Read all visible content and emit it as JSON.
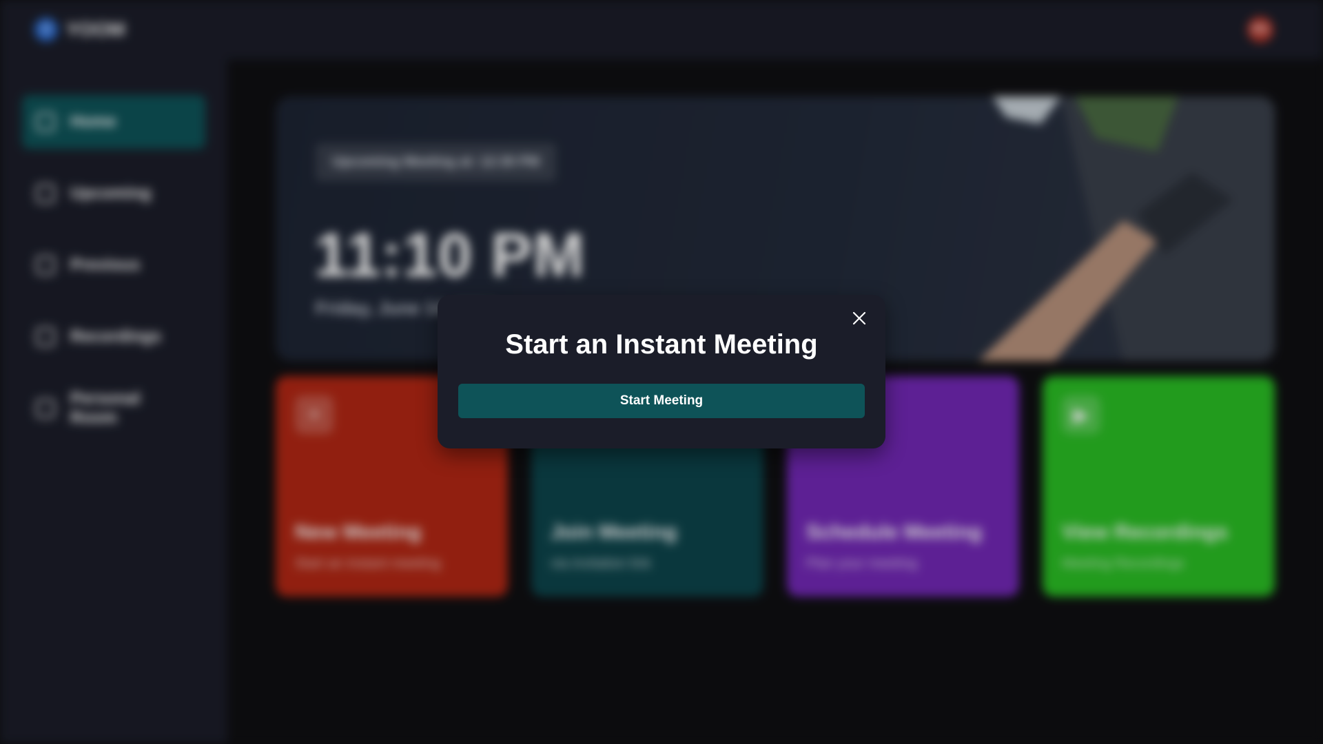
{
  "app": {
    "logo_text": "YOOM",
    "logo_letter": "Y",
    "avatar_initials": "RS"
  },
  "sidebar": {
    "items": [
      {
        "label": "Home",
        "icon": "home-icon"
      },
      {
        "label": "Upcoming",
        "icon": "calendar-icon"
      },
      {
        "label": "Previous",
        "icon": "history-icon"
      },
      {
        "label": "Recordings",
        "icon": "video-icon"
      },
      {
        "label": "Personal Room",
        "icon": "user-plus-icon"
      }
    ],
    "active_index": 0
  },
  "hero": {
    "badge": "Upcoming Meeting at: 12:30 PM",
    "time": "11:10 PM",
    "date": "Friday, June 14, 2024"
  },
  "cards": [
    {
      "title": "New Meeting",
      "subtitle": "Start an instant meeting",
      "icon": "plus-icon",
      "glyph": "+",
      "color": "#b12714"
    },
    {
      "title": "Join Meeting",
      "subtitle": "via invitation link",
      "icon": "user-add-icon",
      "glyph": "☺",
      "color": "#0d444b"
    },
    {
      "title": "Schedule Meeting",
      "subtitle": "Plan your meeting",
      "icon": "calendar-icon",
      "glyph": "▣",
      "color": "#7228b5"
    },
    {
      "title": "View Recordings",
      "subtitle": "Meeting Recordings",
      "icon": "video-icon",
      "glyph": "▶",
      "color": "#2abd24"
    }
  ],
  "modal": {
    "title": "Start an Instant Meeting",
    "button_label": "Start Meeting",
    "close_icon": "close-icon"
  },
  "colors": {
    "accent": "#0e5358",
    "surface": "#1b1d29",
    "background": "#0f0f12"
  }
}
